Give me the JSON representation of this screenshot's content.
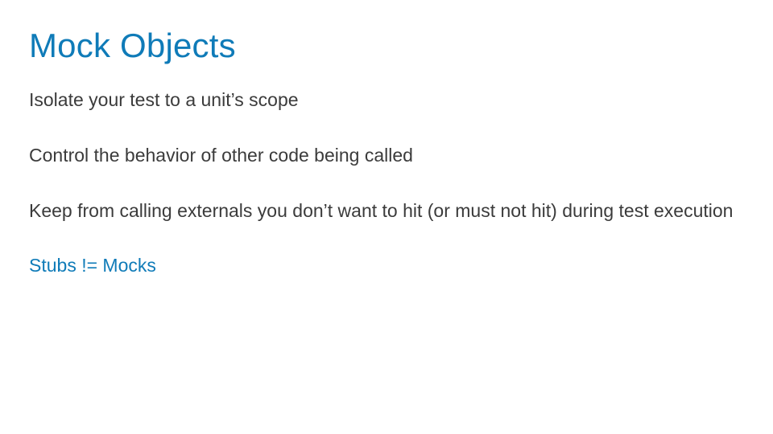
{
  "slide": {
    "title": "Mock Objects",
    "bullets": [
      "Isolate your test to a unit’s scope",
      "Control the behavior of other code being called",
      "Keep from calling externals you don’t want to hit (or must not hit) during test execution",
      "Stubs != Mocks"
    ],
    "accent_color": "#0f7bb8",
    "text_color": "#3b3b3b"
  }
}
